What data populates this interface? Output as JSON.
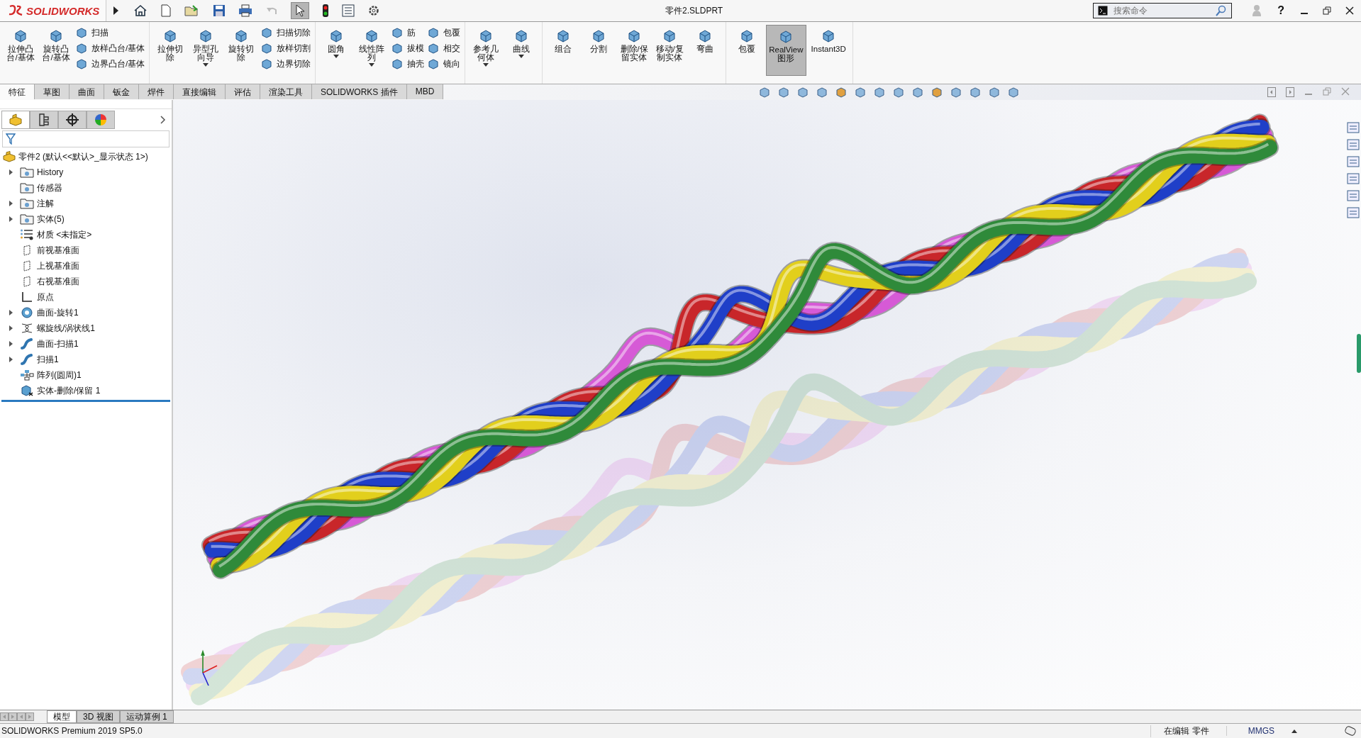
{
  "title_bar": {
    "logo": "SOLIDWORKS",
    "document_title": "零件2.SLDPRT",
    "search": {
      "placeholder": "搜索命令"
    },
    "help": "?"
  },
  "ribbon": {
    "groups": [
      {
        "items": [
          {
            "kind": "large",
            "label": "拉伸凸台/基体",
            "dropdown": false,
            "active": false
          },
          {
            "kind": "large",
            "label": "旋转凸台/基体",
            "dropdown": false,
            "active": false
          },
          {
            "kind": "column",
            "labels": [
              "扫描",
              "放样凸台/基体",
              "边界凸台/基体"
            ]
          }
        ]
      },
      {
        "items": [
          {
            "kind": "large",
            "label": "拉伸切除",
            "dropdown": false,
            "active": false
          },
          {
            "kind": "large",
            "label": "异型孔向导",
            "dropdown": true,
            "active": false
          },
          {
            "kind": "large",
            "label": "旋转切除",
            "dropdown": false,
            "active": false
          },
          {
            "kind": "column",
            "labels": [
              "扫描切除",
              "放样切割",
              "边界切除"
            ]
          }
        ]
      },
      {
        "items": [
          {
            "kind": "large",
            "label": "圆角",
            "dropdown": true,
            "active": false
          },
          {
            "kind": "large",
            "label": "线性阵列",
            "dropdown": true,
            "active": false
          },
          {
            "kind": "column",
            "labels": [
              "筋",
              "拔模",
              "抽壳"
            ]
          },
          {
            "kind": "column",
            "labels": [
              "包覆",
              "相交",
              "镜向"
            ]
          }
        ]
      },
      {
        "items": [
          {
            "kind": "large",
            "label": "参考几何体",
            "dropdown": true,
            "active": false
          },
          {
            "kind": "large",
            "label": "曲线",
            "dropdown": true,
            "active": false
          }
        ]
      },
      {
        "items": [
          {
            "kind": "large",
            "label": "组合",
            "dropdown": false,
            "active": false
          },
          {
            "kind": "large",
            "label": "分割",
            "dropdown": false,
            "active": false
          },
          {
            "kind": "large",
            "label": "删除/保留实体",
            "dropdown": false,
            "active": false
          },
          {
            "kind": "large",
            "label": "移动/复制实体",
            "dropdown": false,
            "active": false
          },
          {
            "kind": "large",
            "label": "弯曲",
            "dropdown": false,
            "active": false
          }
        ]
      },
      {
        "items": [
          {
            "kind": "large",
            "label": "包覆",
            "dropdown": false,
            "active": false
          },
          {
            "kind": "large",
            "label": "RealView 图形",
            "dropdown": false,
            "active": true
          },
          {
            "kind": "large",
            "label": "Instant3D",
            "dropdown": false,
            "active": false
          }
        ]
      }
    ]
  },
  "tabs": [
    {
      "label": "特征",
      "selected": true
    },
    {
      "label": "草图",
      "selected": false
    },
    {
      "label": "曲面",
      "selected": false
    },
    {
      "label": "钣金",
      "selected": false
    },
    {
      "label": "焊件",
      "selected": false
    },
    {
      "label": "直接编辑",
      "selected": false
    },
    {
      "label": "评估",
      "selected": false
    },
    {
      "label": "渲染工具",
      "selected": false
    },
    {
      "label": "SOLIDWORKS 插件",
      "selected": false
    },
    {
      "label": "MBD",
      "selected": false
    }
  ],
  "panel_tabs": [
    {
      "kind": "feature",
      "selected": true
    },
    {
      "kind": "property",
      "selected": false
    },
    {
      "kind": "config",
      "selected": false
    },
    {
      "kind": "display",
      "selected": false
    }
  ],
  "tree": {
    "label": "零件2  (默认<<默认>_显示状态 1>)",
    "children": [
      {
        "label": "History",
        "kind": "folder",
        "expanded": false
      },
      {
        "label": "传感器",
        "kind": "folder"
      },
      {
        "label": "注解",
        "kind": "folder",
        "expanded": false
      },
      {
        "label": "实体(5)",
        "kind": "folder",
        "expanded": false
      },
      {
        "label": "材质 <未指定>",
        "kind": "material"
      },
      {
        "label": "前视基准面",
        "kind": "plane"
      },
      {
        "label": "上视基准面",
        "kind": "plane"
      },
      {
        "label": "右视基准面",
        "kind": "plane"
      },
      {
        "label": "原点",
        "kind": "origin"
      },
      {
        "label": "曲面-旋转1",
        "kind": "revolve",
        "expanded": false
      },
      {
        "label": "螺旋线/涡状线1",
        "kind": "helix",
        "expanded": false
      },
      {
        "label": "曲面-扫描1",
        "kind": "sweep",
        "expanded": false
      },
      {
        "label": "扫描1",
        "kind": "sweep",
        "expanded": false
      },
      {
        "label": "阵列(圆周)1",
        "kind": "pattern"
      },
      {
        "label": "实体-删除/保留 1",
        "kind": "body"
      }
    ]
  },
  "bottom_tabs": [
    {
      "label": "模型",
      "selected": true
    },
    {
      "label": "3D 视图",
      "selected": false
    },
    {
      "label": "运动算例 1",
      "selected": false
    }
  ],
  "status_bar": {
    "product": "SOLIDWORKS Premium 2019 SP5.0",
    "mode": "在编辑 零件",
    "units": "MMGS"
  }
}
